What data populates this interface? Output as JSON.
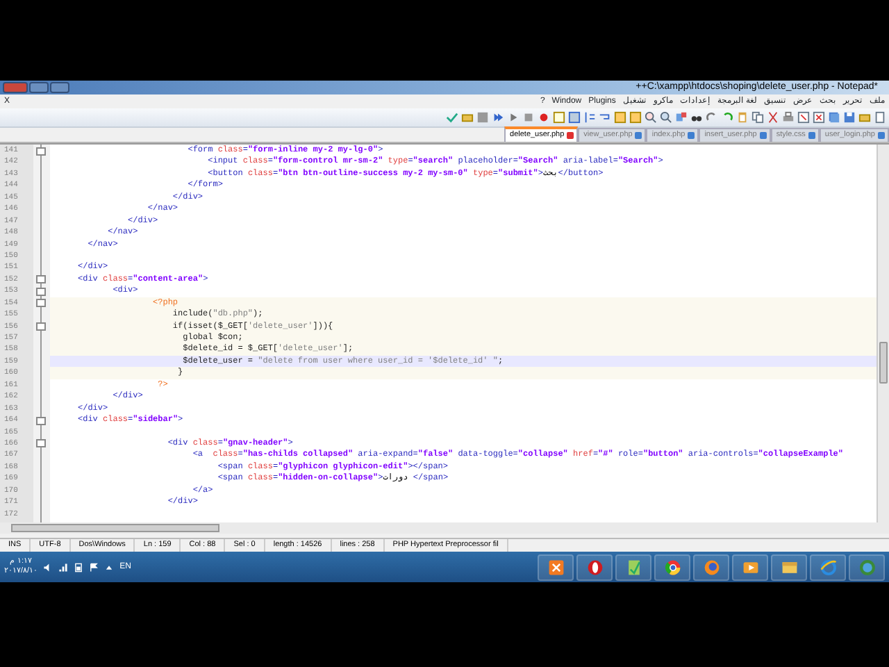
{
  "window": {
    "title": "++C:\\xampp\\htdocs\\shoping\\delete_user.php - Notepad*"
  },
  "menu": {
    "close_label": "X",
    "items": [
      "ملف",
      "تحرير",
      "بحث",
      "عرض",
      "تنسيق",
      "لغة البرمجة",
      "إعدادات",
      "ماكرو",
      "تشغيل",
      "Plugins",
      "Window",
      "?"
    ]
  },
  "tabs": [
    {
      "label": "delete_user.php",
      "selected": true,
      "modified": true
    },
    {
      "label": "view_user.php",
      "selected": false,
      "modified": false
    },
    {
      "label": "index.php",
      "selected": false,
      "modified": false
    },
    {
      "label": "insert_user.php",
      "selected": false,
      "modified": false
    },
    {
      "label": "style.css",
      "selected": false,
      "modified": false
    },
    {
      "label": "user_login.php",
      "selected": false,
      "modified": false
    }
  ],
  "editor": {
    "lines": [
      {
        "number": "141",
        "fold": true,
        "current": false,
        "embedded": false,
        "segments": [
          {
            "kind": "tag",
            "text": "                           <form "
          },
          {
            "kind": "attr",
            "text": "class"
          },
          {
            "kind": "tag",
            "text": "="
          },
          {
            "kind": "value",
            "text": "\"form-inline my-2 my-lg-0\""
          },
          {
            "kind": "tag",
            "text": ">"
          }
        ]
      },
      {
        "number": "142",
        "fold": false,
        "current": false,
        "embedded": false,
        "segments": [
          {
            "kind": "tag",
            "text": "                               <input "
          },
          {
            "kind": "attr",
            "text": "class"
          },
          {
            "kind": "tag",
            "text": "="
          },
          {
            "kind": "value",
            "text": "\"form-control mr-sm-2\""
          },
          {
            "kind": "attr",
            "text": " type"
          },
          {
            "kind": "tag",
            "text": "="
          },
          {
            "kind": "value",
            "text": "\"search\""
          },
          {
            "kind": "tag",
            "text": " placeholder="
          },
          {
            "kind": "value",
            "text": "\"Search\""
          },
          {
            "kind": "tag",
            "text": " aria-label="
          },
          {
            "kind": "value",
            "text": "\"Search\""
          },
          {
            "kind": "tag",
            "text": ">"
          }
        ]
      },
      {
        "number": "143",
        "fold": false,
        "current": false,
        "embedded": false,
        "segments": [
          {
            "kind": "tag",
            "text": "                               <button "
          },
          {
            "kind": "attr",
            "text": "class"
          },
          {
            "kind": "tag",
            "text": "="
          },
          {
            "kind": "value",
            "text": "\"btn btn-outline-success my-2 my-sm-0\""
          },
          {
            "kind": "attr",
            "text": " type"
          },
          {
            "kind": "tag",
            "text": "="
          },
          {
            "kind": "value",
            "text": "\"submit\""
          },
          {
            "kind": "tag",
            "text": ">"
          },
          {
            "kind": "plain",
            "text": "بحث"
          },
          {
            "kind": "tag",
            "text": "</button>"
          }
        ]
      },
      {
        "number": "144",
        "fold": false,
        "current": false,
        "embedded": false,
        "segments": [
          {
            "kind": "tag",
            "text": "                           </form>"
          }
        ]
      },
      {
        "number": "145",
        "fold": false,
        "current": false,
        "embedded": false,
        "segments": [
          {
            "kind": "tag",
            "text": "                        </div>"
          }
        ]
      },
      {
        "number": "146",
        "fold": false,
        "current": false,
        "embedded": false,
        "segments": [
          {
            "kind": "tag",
            "text": "                   </nav>"
          }
        ]
      },
      {
        "number": "147",
        "fold": false,
        "current": false,
        "embedded": false,
        "segments": [
          {
            "kind": "tag",
            "text": "               </div>"
          }
        ]
      },
      {
        "number": "148",
        "fold": false,
        "current": false,
        "embedded": false,
        "segments": [
          {
            "kind": "tag",
            "text": "           </nav>"
          }
        ]
      },
      {
        "number": "149",
        "fold": false,
        "current": false,
        "embedded": false,
        "segments": [
          {
            "kind": "tag",
            "text": "       </nav>"
          }
        ]
      },
      {
        "number": "150",
        "fold": false
      },
      {
        "number": "151",
        "fold": false,
        "current": false,
        "embedded": false,
        "segments": [
          {
            "kind": "tag",
            "text": "     </div>"
          }
        ]
      },
      {
        "number": "152",
        "fold": true,
        "current": false,
        "embedded": false,
        "segments": [
          {
            "kind": "tag",
            "text": "     <div "
          },
          {
            "kind": "attr",
            "text": "class"
          },
          {
            "kind": "tag",
            "text": "="
          },
          {
            "kind": "value",
            "text": "\"content-area\""
          },
          {
            "kind": "tag",
            "text": ">"
          }
        ]
      },
      {
        "number": "153",
        "fold": true,
        "current": false,
        "embedded": false,
        "segments": [
          {
            "kind": "tag",
            "text": "            <div>"
          }
        ]
      },
      {
        "number": "154",
        "fold": true,
        "current": false,
        "embedded": true,
        "segments": [
          {
            "kind": "delim",
            "text": "                    <?php"
          }
        ]
      },
      {
        "number": "155",
        "fold": false,
        "current": false,
        "embedded": true,
        "segments": [
          {
            "kind": "php",
            "text": "                        include("
          },
          {
            "kind": "string",
            "text": "\"db.php\""
          },
          {
            "kind": "php",
            "text": ");"
          }
        ]
      },
      {
        "number": "156",
        "fold": true,
        "current": false,
        "embedded": true,
        "segments": [
          {
            "kind": "php",
            "text": "                        if(isset($_GET["
          },
          {
            "kind": "string",
            "text": "'delete_user'"
          },
          {
            "kind": "php",
            "text": "])){"
          }
        ]
      },
      {
        "number": "157",
        "fold": false,
        "current": false,
        "embedded": true,
        "segments": [
          {
            "kind": "php",
            "text": "                          global $con;"
          }
        ]
      },
      {
        "number": "158",
        "fold": false,
        "current": false,
        "embedded": true,
        "segments": [
          {
            "kind": "php",
            "text": "                          $delete_id = $_GET["
          },
          {
            "kind": "string",
            "text": "'delete_user'"
          },
          {
            "kind": "php",
            "text": "];"
          }
        ]
      },
      {
        "number": "159",
        "fold": false,
        "current": true,
        "embedded": true,
        "segments": [
          {
            "kind": "php",
            "text": "                          $delete_user = "
          },
          {
            "kind": "string",
            "text": "\"delete from user where user_id = '$delete_id' \""
          },
          {
            "kind": "php",
            "text": ";"
          }
        ]
      },
      {
        "number": "160",
        "fold": false,
        "current": false,
        "embedded": true,
        "segments": [
          {
            "kind": "php",
            "text": "                         }"
          }
        ]
      },
      {
        "number": "161",
        "fold": false,
        "current": false,
        "embedded": false,
        "segments": [
          {
            "kind": "delim",
            "text": "                     ?>"
          }
        ]
      },
      {
        "number": "162",
        "fold": false,
        "current": false,
        "embedded": false,
        "segments": [
          {
            "kind": "tag",
            "text": "            </div>"
          }
        ]
      },
      {
        "number": "163",
        "fold": false,
        "current": false,
        "embedded": false,
        "segments": [
          {
            "kind": "tag",
            "text": "     </div>"
          }
        ]
      },
      {
        "number": "164",
        "fold": true,
        "current": false,
        "embedded": false,
        "segments": [
          {
            "kind": "tag",
            "text": "     <div "
          },
          {
            "kind": "attr",
            "text": "class"
          },
          {
            "kind": "tag",
            "text": "="
          },
          {
            "kind": "value",
            "text": "\"sidebar\""
          },
          {
            "kind": "tag",
            "text": ">"
          }
        ]
      },
      {
        "number": "165",
        "fold": false
      },
      {
        "number": "166",
        "fold": true,
        "current": false,
        "embedded": false,
        "segments": [
          {
            "kind": "tag",
            "text": "                       <div "
          },
          {
            "kind": "attr",
            "text": "class"
          },
          {
            "kind": "tag",
            "text": "="
          },
          {
            "kind": "value",
            "text": "\"gnav-header\""
          },
          {
            "kind": "tag",
            "text": ">"
          }
        ]
      },
      {
        "number": "167",
        "fold": false,
        "current": false,
        "embedded": false,
        "segments": [
          {
            "kind": "tag",
            "text": "                            <a  "
          },
          {
            "kind": "attr",
            "text": "class"
          },
          {
            "kind": "tag",
            "text": "="
          },
          {
            "kind": "value",
            "text": "\"has-childs collapsed\""
          },
          {
            "kind": "tag",
            "text": " aria-expand="
          },
          {
            "kind": "value",
            "text": "\"false\""
          },
          {
            "kind": "tag",
            "text": " data-toggle="
          },
          {
            "kind": "value",
            "text": "\"collapse\""
          },
          {
            "kind": "attr",
            "text": " href"
          },
          {
            "kind": "tag",
            "text": "="
          },
          {
            "kind": "value",
            "text": "\"#\""
          },
          {
            "kind": "tag",
            "text": " role="
          },
          {
            "kind": "value",
            "text": "\"button\""
          },
          {
            "kind": "tag",
            "text": " aria-controls="
          },
          {
            "kind": "value",
            "text": "\"collapseExample\""
          }
        ]
      },
      {
        "number": "168",
        "fold": false,
        "current": false,
        "embedded": false,
        "segments": [
          {
            "kind": "tag",
            "text": "                                 <span "
          },
          {
            "kind": "attr",
            "text": "class"
          },
          {
            "kind": "tag",
            "text": "="
          },
          {
            "kind": "value",
            "text": "\"glyphicon glyphicon-edit\""
          },
          {
            "kind": "tag",
            "text": "></span>"
          }
        ]
      },
      {
        "number": "169",
        "fold": false,
        "current": false,
        "embedded": false,
        "segments": [
          {
            "kind": "tag",
            "text": "                                 <span "
          },
          {
            "kind": "attr",
            "text": "class"
          },
          {
            "kind": "tag",
            "text": "="
          },
          {
            "kind": "value",
            "text": "\"hidden-on-collapse\""
          },
          {
            "kind": "tag",
            "text": ">"
          },
          {
            "kind": "plain",
            "text": "دورات "
          },
          {
            "kind": "tag",
            "text": "</span>"
          }
        ]
      },
      {
        "number": "170",
        "fold": false,
        "current": false,
        "embedded": false,
        "segments": [
          {
            "kind": "tag",
            "text": "                            </a>"
          }
        ]
      },
      {
        "number": "171",
        "fold": false,
        "current": false,
        "embedded": false,
        "segments": [
          {
            "kind": "tag",
            "text": "                       </div>"
          }
        ]
      },
      {
        "number": "172",
        "fold": false
      }
    ]
  },
  "status_bar": [
    "INS",
    "UTF-8",
    "Dos\\Windows",
    "Ln : 159",
    "Col : 88",
    "Sel : 0",
    "length : 14526",
    "lines : 258",
    "PHP Hypertext Preprocessor fil"
  ],
  "taskbar": {
    "clock_time": "١:١٧ م",
    "clock_date": "٢٠١٧/٨/١٠",
    "language": "EN"
  }
}
